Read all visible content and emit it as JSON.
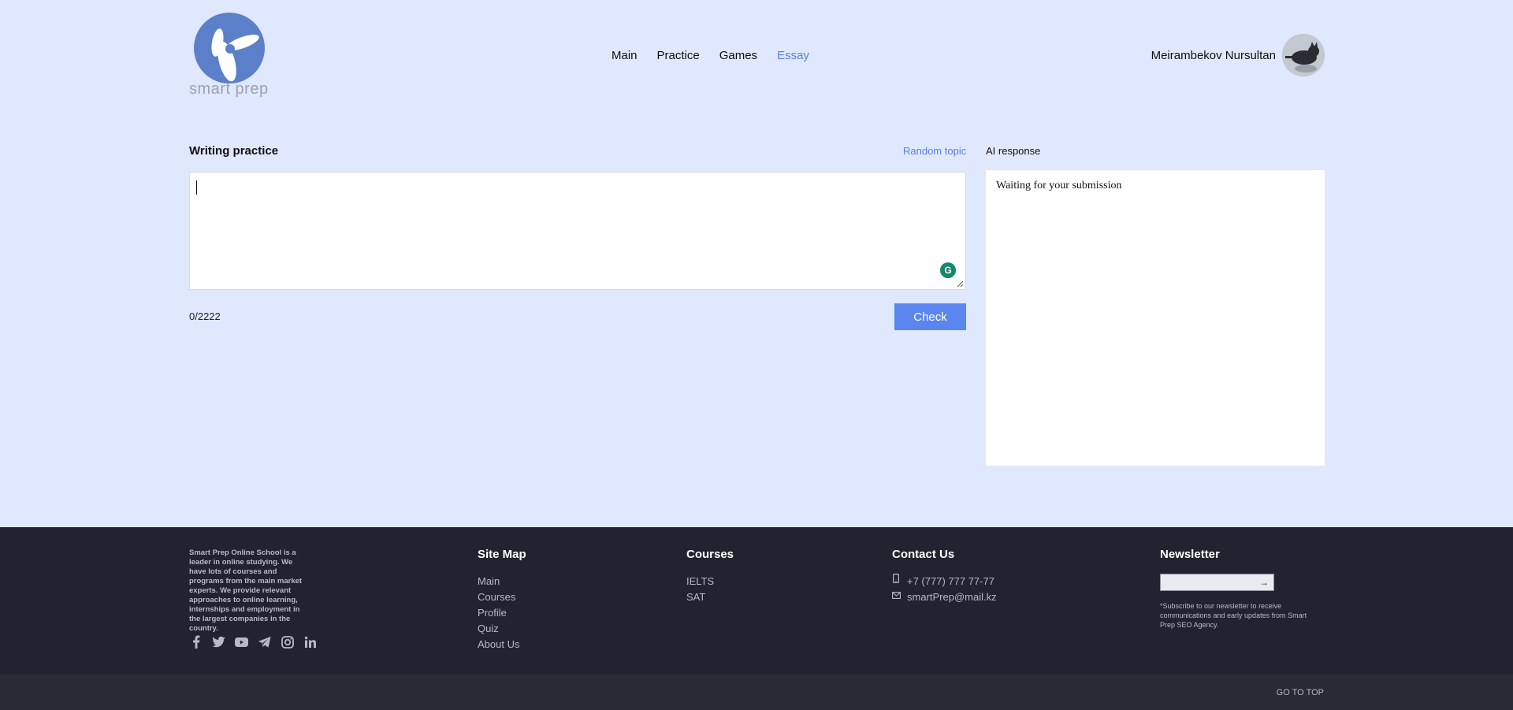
{
  "header": {
    "logo_text": "smart prep",
    "nav": [
      {
        "label": "Main"
      },
      {
        "label": "Practice"
      },
      {
        "label": "Games"
      },
      {
        "label": "Essay",
        "active": true
      }
    ],
    "user_name": "Meirambekov Nursultan"
  },
  "writing": {
    "title": "Writing practice",
    "random_topic": "Random topic",
    "essay_value": "",
    "counter": "0/2222",
    "check_label": "Check"
  },
  "ai": {
    "title": "AI response",
    "text": "Waiting for your submission"
  },
  "footer": {
    "about": "Smart Prep Online School is a leader in online studying. We have lots of courses and programs from the main market experts. We provide relevant approaches to online learning, internships and employment in the largest companies in the country.",
    "socials": [
      "facebook-icon",
      "twitter-icon",
      "youtube-icon",
      "telegram-icon",
      "instagram-icon",
      "linkedin-icon"
    ],
    "sitemap": {
      "title": "Site Map",
      "links": [
        "Main",
        "Courses",
        "Profile",
        "Quiz",
        "About Us"
      ]
    },
    "courses": {
      "title": "Courses",
      "links": [
        "IELTS",
        "SAT"
      ]
    },
    "contact": {
      "title": "Contact Us",
      "phone": "+7 (777) 777 77-77",
      "email": "smartPrep@mail.kz"
    },
    "newsletter": {
      "title": "Newsletter",
      "input_value": "",
      "note": "*Subscribe to our newsletter to receive communications and early updates from Smart Prep SEO Agency."
    },
    "go_to_top": "GO TO TOP"
  },
  "colors": {
    "background": "#dfe8fc",
    "accent": "#5b86f0",
    "footer": "#212330",
    "logo": "#5b7fc9"
  }
}
